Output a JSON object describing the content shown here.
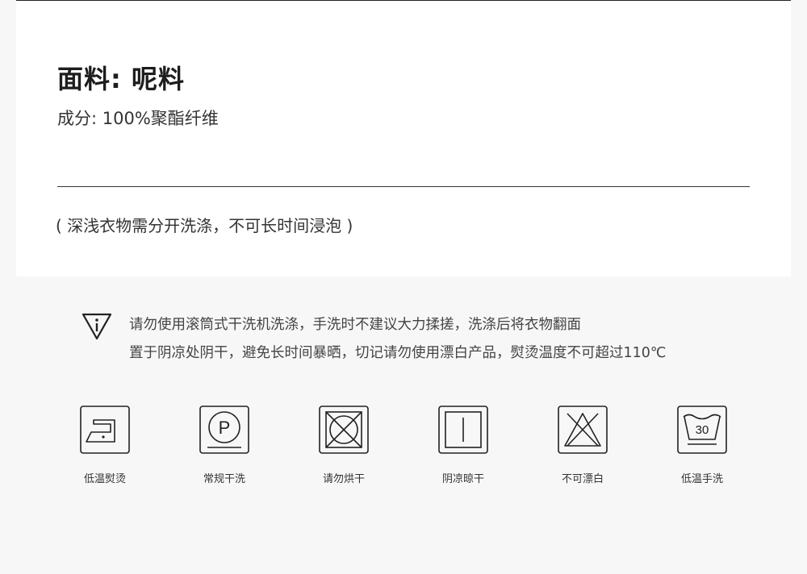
{
  "fabric": {
    "title": "面料: 呢料",
    "composition": "成分: 100%聚酯纤维",
    "wash_note": "( 深浅衣物需分开洗涤，不可长时间浸泡 )"
  },
  "warning": {
    "icon": "warning-triangle-icon",
    "line1": "请勿使用滚筒式干洗机洗涤，手洗时不建议大力揉搓，洗涤后将衣物翻面",
    "line2": "置于阴凉处阴干，避免长时间暴晒，切记请勿使用漂白产品，熨烫温度不可超过110℃"
  },
  "care_icons": [
    {
      "label": "低温熨烫",
      "icon": "iron-low-temp-icon"
    },
    {
      "label": "常规干洗",
      "icon": "dry-clean-p-icon"
    },
    {
      "label": "请勿烘干",
      "icon": "do-not-tumble-dry-icon"
    },
    {
      "label": "阴凉晾干",
      "icon": "shade-dry-icon"
    },
    {
      "label": "不可漂白",
      "icon": "do-not-bleach-icon"
    },
    {
      "label": "低温手洗",
      "icon": "hand-wash-30-icon",
      "temp": "30"
    }
  ]
}
